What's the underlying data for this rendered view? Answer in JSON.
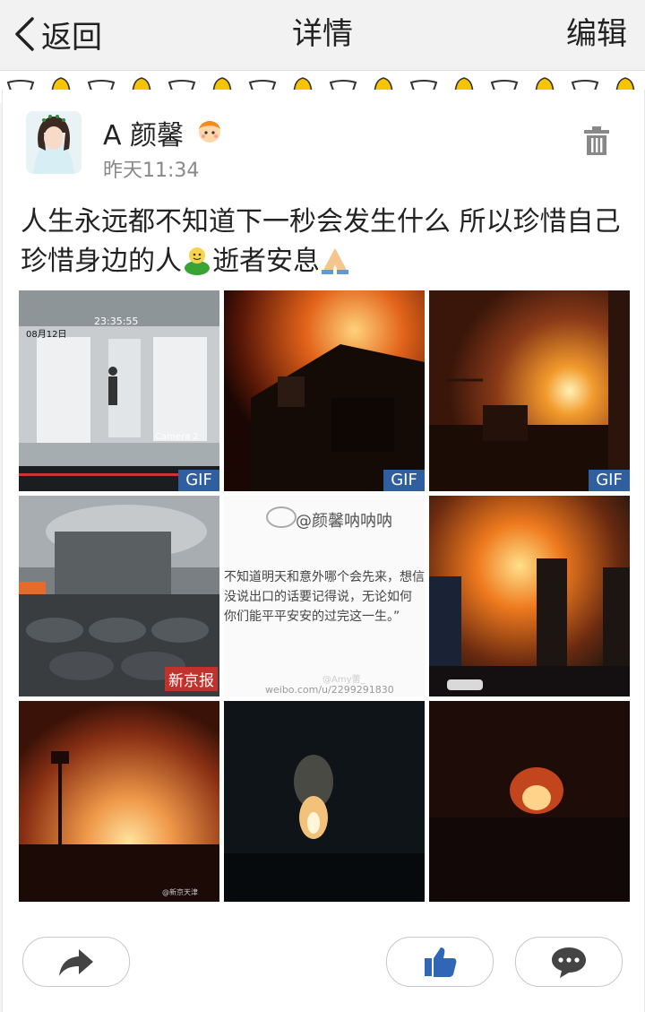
{
  "header": {
    "back_label": "返回",
    "title": "详情",
    "edit_label": "编辑"
  },
  "post": {
    "user_name": "A 颜馨",
    "time": "昨天11:34",
    "text_part1": "人生永远都不知道下一秒会发生什么 所以珍惜自己 珍惜身边的人",
    "text_part2": "逝者安息"
  },
  "images": {
    "gif_label": "GIF",
    "weibo_watermark": "@颜馨呐呐呐",
    "quote_lines": [
      "不知道明天和意外哪个会先来，想信",
      "没说出口的话要记得说，无论如何",
      "你们能平平安安的过完这一生。”"
    ],
    "quote_credit_handle": "@Amy蕾_",
    "quote_credit_url": "weibo.com/u/2299291830",
    "xinjingbao": "新京报",
    "cctv_timestamp": "23:35:55",
    "cctv_date": "08月12日",
    "cctv_camera": "Camera 2"
  },
  "colors": {
    "accent_blue": "#2f5f9f",
    "icon_gray": "#444444",
    "like_blue": "#2f66b5"
  }
}
